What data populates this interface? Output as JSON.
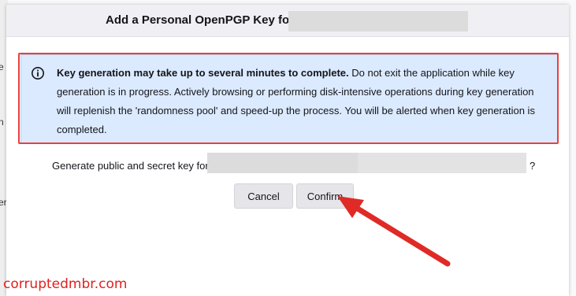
{
  "dialog": {
    "title": "Add a Personal OpenPGP Key for"
  },
  "notice": {
    "icon": "info-icon",
    "bold_text": "Key generation may take up to several minutes to complete.",
    "body_text": " Do not exit the application while key generation is in progress. Actively browsing or performing disk-intensive operations during key generation will replenish the 'randomness pool' and speed-up the process. You will be alerted when key generation is completed."
  },
  "question": {
    "text": "Generate public and secret key for",
    "suffix": "?"
  },
  "buttons": {
    "cancel_label": "Cancel",
    "confirm_label": "Confirm"
  },
  "background": {
    "fragment_1": "e",
    "fragment_2": "n",
    "fragment_3": "er"
  },
  "watermark": {
    "text": "corruptedmbr.com"
  },
  "colors": {
    "highlight": "#e8403c",
    "notice_bg": "#dbeafe",
    "button_bg": "#e6e6ea",
    "watermark": "#e02020"
  }
}
